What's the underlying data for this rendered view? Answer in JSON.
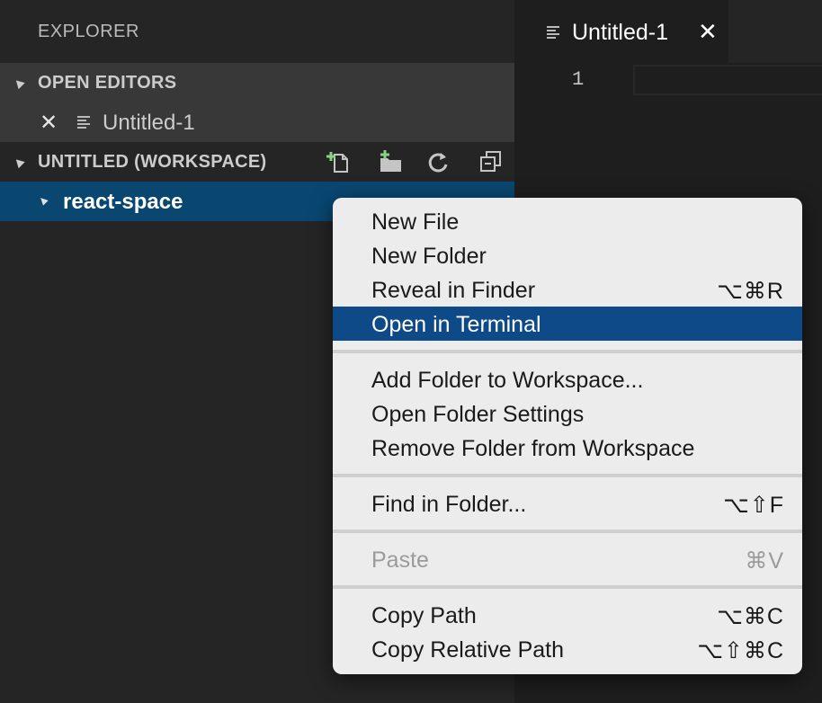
{
  "sidebar": {
    "title": "EXPLORER",
    "open_editors": {
      "header": "OPEN EDITORS",
      "items": [
        {
          "name": "Untitled-1"
        }
      ]
    },
    "workspace": {
      "header": "UNTITLED (WORKSPACE)",
      "actions": [
        "new-file-icon",
        "new-folder-icon",
        "refresh-icon",
        "collapse-all-icon"
      ],
      "folders": [
        {
          "name": "react-space"
        }
      ]
    }
  },
  "editor": {
    "tab": {
      "title": "Untitled-1"
    },
    "line_numbers": [
      "1"
    ]
  },
  "context_menu": {
    "items": [
      {
        "label": "New File",
        "shortcut": ""
      },
      {
        "label": "New Folder",
        "shortcut": ""
      },
      {
        "label": "Reveal in Finder",
        "shortcut": "⌥⌘R"
      },
      {
        "label": "Open in Terminal",
        "shortcut": "",
        "highlighted": true
      },
      {
        "label": "Add Folder to Workspace...",
        "shortcut": ""
      },
      {
        "label": "Open Folder Settings",
        "shortcut": ""
      },
      {
        "label": "Remove Folder from Workspace",
        "shortcut": ""
      },
      {
        "label": "Find in Folder...",
        "shortcut": "⌥⇧F"
      },
      {
        "label": "Paste",
        "shortcut": "⌘V",
        "disabled": true
      },
      {
        "label": "Copy Path",
        "shortcut": "⌥⌘C"
      },
      {
        "label": "Copy Relative Path",
        "shortcut": "⌥⇧⌘C"
      }
    ]
  },
  "colors": {
    "selection": "#094771",
    "menu_highlight": "#0e4a88",
    "icon_add_green": "#89d185"
  }
}
